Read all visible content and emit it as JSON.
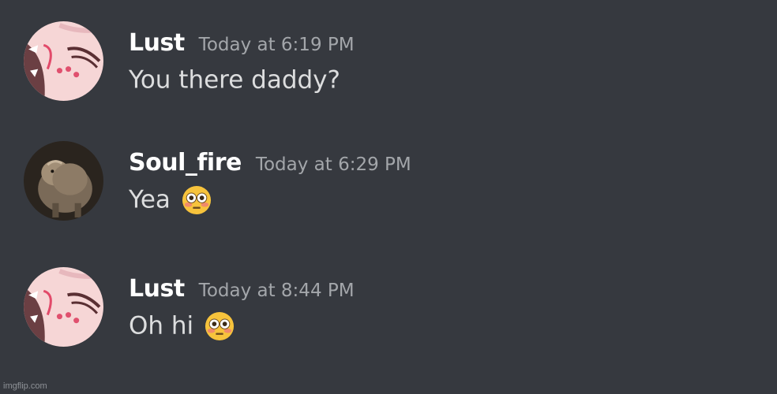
{
  "messages": [
    {
      "username": "Lust",
      "timestamp": "Today at 6:19 PM",
      "text": "You there daddy?",
      "avatar_icon": "lust-avatar-icon",
      "emoji": null
    },
    {
      "username": "Soul_fire",
      "timestamp": "Today at 6:29 PM",
      "text": "Yea",
      "avatar_icon": "lion-avatar-icon",
      "emoji": "flushed-face-emoji"
    },
    {
      "username": "Lust",
      "timestamp": "Today at 8:44 PM",
      "text": "Oh hi",
      "avatar_icon": "lust-avatar-icon",
      "emoji": "flushed-face-emoji"
    }
  ],
  "watermark": "imgflip.com",
  "colors": {
    "background": "#36393f",
    "username": "#ffffff",
    "timestamp": "#a3a6aa",
    "message_text": "#dcddde"
  }
}
